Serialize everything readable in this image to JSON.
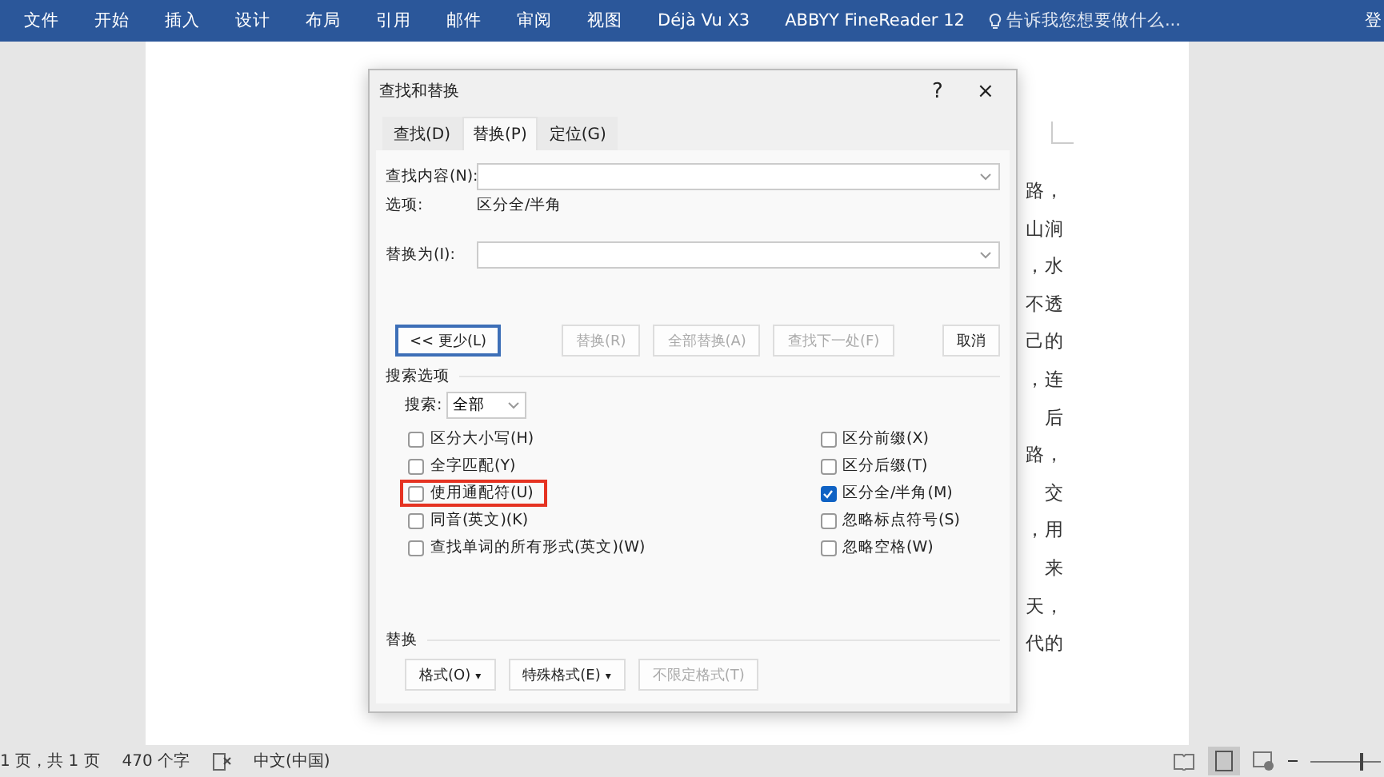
{
  "ribbon": {
    "tabs": [
      {
        "label": "文件",
        "selected": false
      },
      {
        "label": "开始",
        "selected": false
      },
      {
        "label": "插入",
        "selected": false
      },
      {
        "label": "设计",
        "selected": false
      },
      {
        "label": "布局",
        "selected": false
      },
      {
        "label": "引用",
        "selected": false
      },
      {
        "label": "邮件",
        "selected": false
      },
      {
        "label": "审阅",
        "selected": false
      },
      {
        "label": "视图",
        "selected": false
      },
      {
        "label": "Déjà Vu X3",
        "selected": false
      },
      {
        "label": "ABBYY FineReader 12",
        "selected": false
      }
    ],
    "tell_me": "告诉我您想要做什么...",
    "account": "登"
  },
  "document": {
    "lines": [
      "路，",
      "山涧",
      "，水",
      "不透",
      "己的",
      "，连",
      "后",
      "路，",
      "交",
      "，用",
      "来",
      "天，",
      "代的"
    ]
  },
  "dialog": {
    "title": "查找和替换",
    "help": "?",
    "close": "×",
    "tabs": [
      {
        "label": "查找(D)",
        "selected": false
      },
      {
        "label": "替换(P)",
        "selected": true
      },
      {
        "label": "定位(G)",
        "selected": false
      }
    ],
    "find_label": "查找内容(N):",
    "options_label": "选项:",
    "options_value": "区分全/半角",
    "replace_label": "替换为(I):",
    "buttons": [
      {
        "label": "<< 更少(L)",
        "disabled": false,
        "default": true
      },
      {
        "label": "替换(R)",
        "disabled": true,
        "default": false
      },
      {
        "label": "全部替换(A)",
        "disabled": true,
        "default": false
      },
      {
        "label": "查找下一处(F)",
        "disabled": true,
        "default": false
      },
      {
        "label": "取消",
        "disabled": false,
        "default": false
      }
    ],
    "search_options_title": "搜索选项",
    "search_label": "搜索:",
    "search_value": "全部",
    "left_options": [
      {
        "label": "区分大小写(H)",
        "checked": false,
        "highlighted": false
      },
      {
        "label": "全字匹配(Y)",
        "checked": false,
        "highlighted": false
      },
      {
        "label": "使用通配符(U)",
        "checked": false,
        "highlighted": true
      },
      {
        "label": "同音(英文)(K)",
        "checked": false,
        "highlighted": false
      },
      {
        "label": "查找单词的所有形式(英文)(W)",
        "checked": false,
        "highlighted": false
      }
    ],
    "right_options": [
      {
        "label": "区分前缀(X)",
        "checked": false,
        "highlighted": false
      },
      {
        "label": "区分后缀(T)",
        "checked": false,
        "highlighted": false
      },
      {
        "label": "区分全/半角(M)",
        "checked": true,
        "highlighted": false
      },
      {
        "label": "忽略标点符号(S)",
        "checked": false,
        "highlighted": false
      },
      {
        "label": "忽略空格(W)",
        "checked": false,
        "highlighted": false
      }
    ],
    "replace_title": "替换",
    "replace_buttons": [
      {
        "label": "格式(O)",
        "disabled": false,
        "caret": "▾"
      },
      {
        "label": "特殊格式(E)",
        "disabled": false,
        "caret": "▾"
      },
      {
        "label": "不限定格式(T)",
        "disabled": true
      }
    ]
  },
  "status_bar": {
    "page": "1 页，共 1 页",
    "words": "470 个字",
    "language": "中文(中国)",
    "zoom": {
      "level": 0.7
    }
  }
}
